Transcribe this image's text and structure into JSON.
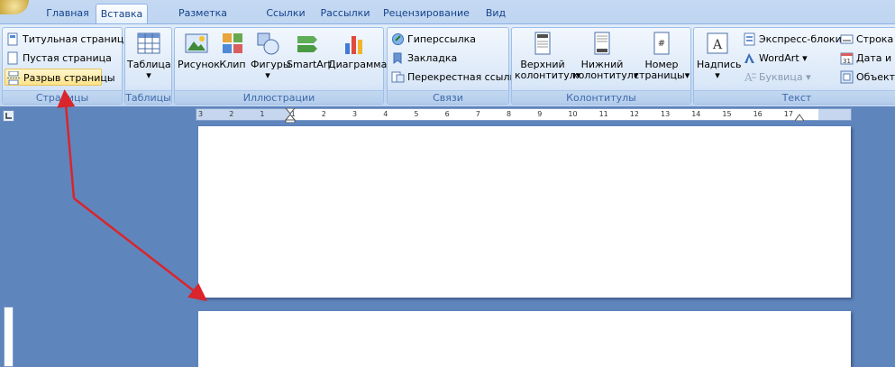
{
  "tabs": [
    {
      "label": "Главная"
    },
    {
      "label": "Вставка"
    },
    {
      "label": "Разметка страницы"
    },
    {
      "label": "Ссылки"
    },
    {
      "label": "Рассылки"
    },
    {
      "label": "Рецензирование"
    },
    {
      "label": "Вид"
    }
  ],
  "groups": {
    "pages": {
      "label": "Страницы",
      "cover": "Титульная страница",
      "blank": "Пустая страница",
      "page_break": "Разрыв страницы"
    },
    "tables": {
      "label": "Таблицы",
      "table": "Таблица"
    },
    "illustrations": {
      "label": "Иллюстрации",
      "picture": "Рисунок",
      "clip": "Клип",
      "shapes": "Фигуры",
      "smartart": "SmartArt",
      "chart": "Диаграмма"
    },
    "links": {
      "label": "Связи",
      "hyperlink": "Гиперссылка",
      "bookmark": "Закладка",
      "crossref": "Перекрестная ссылка"
    },
    "headers": {
      "label": "Колонтитулы",
      "header_l1": "Верхний",
      "header_l2": "колонтитул",
      "footer_l1": "Нижний",
      "footer_l2": "колонтитул",
      "pagenum_l1": "Номер",
      "pagenum_l2": "страницы"
    },
    "text": {
      "label": "Текст",
      "textbox": "Надпись",
      "quickparts": "Экспресс-блоки",
      "wordart": "WordArt",
      "dropcap": "Буквица",
      "sigline": "Строка п",
      "datetime": "Дата и вр",
      "object": "Объект"
    }
  },
  "ruler": {
    "labels": [
      "3",
      "2",
      "1",
      "1",
      "2",
      "3",
      "4",
      "5",
      "6",
      "7",
      "8",
      "9",
      "10",
      "11",
      "12",
      "13",
      "14",
      "15",
      "16",
      "17"
    ]
  },
  "colors": {
    "accent": "#15428b",
    "arrow": "#d9252b",
    "workspace": "#5f85bd"
  }
}
